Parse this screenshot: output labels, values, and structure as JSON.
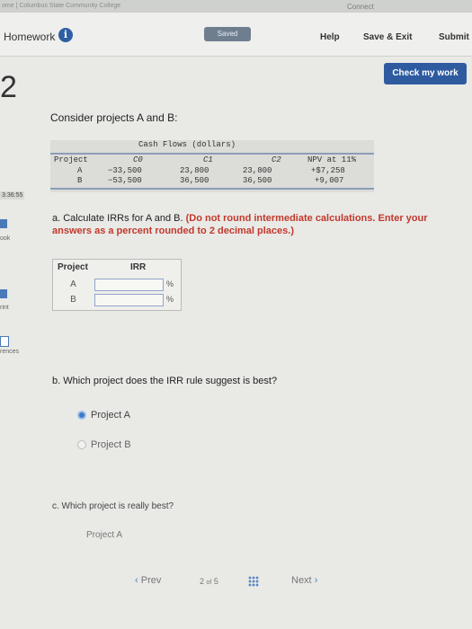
{
  "browser": {
    "crumb": "ome | Columbus State Community College",
    "connect": "Connect"
  },
  "header": {
    "title": "Homework",
    "info_icon": "info-icon",
    "saved_label": "Saved",
    "help_label": "Help",
    "save_exit_label": "Save & Exit",
    "submit_label": "Submit"
  },
  "check_button": "Check my work",
  "question_number": "2",
  "timer": "3:36:55",
  "sidebar": {
    "items": [
      "ook",
      "rint",
      "rences"
    ]
  },
  "problem": {
    "prompt": "Consider projects A and B:",
    "table": {
      "caption": "Cash Flows (dollars)",
      "headers": [
        "Project",
        "C0",
        "C1",
        "C2",
        "NPV at 11%"
      ],
      "rows": [
        [
          "A",
          "−33,500",
          "23,800",
          "23,800",
          "+$7,258"
        ],
        [
          "B",
          "−53,500",
          "36,500",
          "36,500",
          "+9,007"
        ]
      ]
    }
  },
  "part_a": {
    "text": "a. Calculate IRRs for A and B.",
    "instruction": "(Do not round intermediate calculations. Enter your answers as a percent rounded to 2 decimal places.)",
    "table": {
      "headers": [
        "Project",
        "IRR"
      ],
      "rows": [
        {
          "label": "A",
          "value": "",
          "unit": "%"
        },
        {
          "label": "B",
          "value": "",
          "unit": "%"
        }
      ]
    }
  },
  "part_b": {
    "text": "b. Which project does the IRR rule suggest is best?",
    "options": [
      {
        "label": "Project A",
        "selected": true
      },
      {
        "label": "Project B",
        "selected": false
      }
    ]
  },
  "part_c": {
    "text": "c. Which project is really best?",
    "selected": "Project A"
  },
  "footer": {
    "prev": "Prev",
    "page": "2",
    "of": "of",
    "total": "5",
    "next": "Next"
  }
}
